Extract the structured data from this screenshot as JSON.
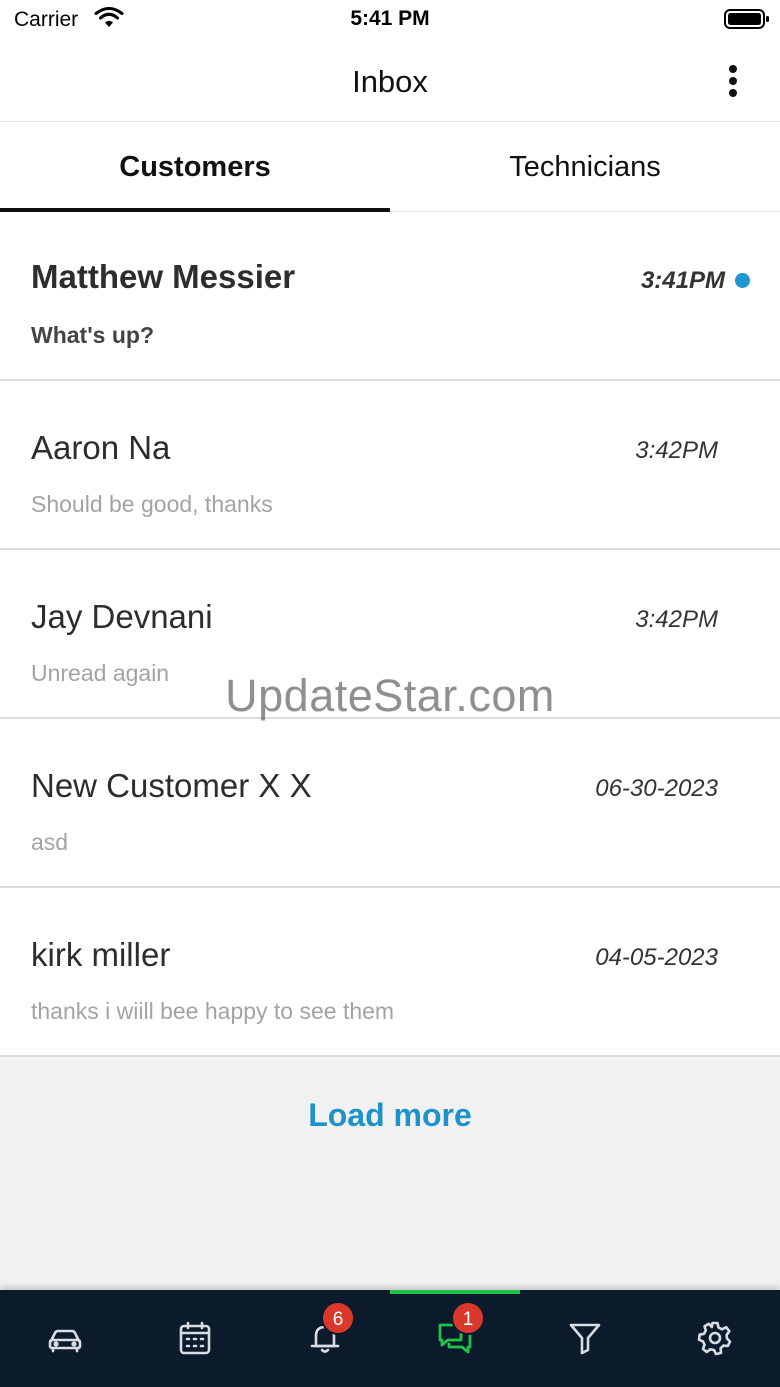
{
  "status_bar": {
    "carrier": "Carrier",
    "time": "5:41 PM"
  },
  "header": {
    "title": "Inbox",
    "more_icon": "more-vertical-icon"
  },
  "tabs": [
    {
      "label": "Customers",
      "active": true
    },
    {
      "label": "Technicians",
      "active": false
    }
  ],
  "conversations": [
    {
      "name": "Matthew Messier",
      "message": "What's up?",
      "time": "3:41PM",
      "unread": true
    },
    {
      "name": "Aaron Na",
      "message": "Should be good, thanks",
      "time": "3:42PM",
      "unread": false
    },
    {
      "name": "Jay Devnani",
      "message": "Unread again",
      "time": "3:42PM",
      "unread": false
    },
    {
      "name": "New Customer X X",
      "message": "asd",
      "time": "06-30-2023",
      "unread": false
    },
    {
      "name": "kirk miller",
      "message": "thanks i wiill bee happy to see them",
      "time": "04-05-2023",
      "unread": false
    }
  ],
  "load_more_label": "Load more",
  "watermark": "UpdateStar.com",
  "tab_bar": {
    "items": [
      {
        "icon": "car-icon"
      },
      {
        "icon": "calendar-icon"
      },
      {
        "icon": "bell-icon",
        "badge": "6"
      },
      {
        "icon": "chat-icon",
        "badge": "1",
        "active": true
      },
      {
        "icon": "filter-icon"
      },
      {
        "icon": "gear-icon"
      }
    ]
  },
  "colors": {
    "accent": "#1e93c9",
    "unread_dot": "#1f97cf",
    "tab_bar_bg": "#0b1b2c",
    "active_tab": "#22c24a",
    "badge": "#d8392b"
  }
}
